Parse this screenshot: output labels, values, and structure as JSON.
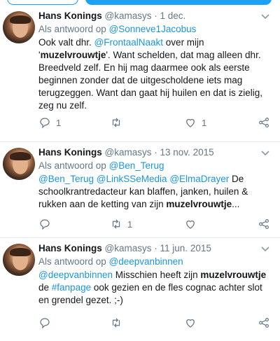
{
  "tweets": [
    {
      "name": "Hans Konings",
      "handle": "@kamasys",
      "sep": "·",
      "date": "1 dec.",
      "reply_prefix": "Als antwoord op ",
      "reply_handles": [
        "@Sonneve1Jacobus"
      ],
      "body": [
        {
          "t": "Ook valt dhr. "
        },
        {
          "t": "@FrontaalNaakt",
          "link": true
        },
        {
          "t": " over mijn '"
        },
        {
          "t": "muzelvrouwtje",
          "bold": true
        },
        {
          "t": "'. Want schelden, dat mag alleen dhr. Breedveld zelf. En hij mag daarmee ook als eerste beginnen zonder dat de uitgescholdene iets mag terugzeggen. Want dan gaat hij huilen en dat is zielig, zeg nu zelf."
        }
      ],
      "counts": {
        "reply": "1",
        "retweet": "",
        "like": "1"
      }
    },
    {
      "name": "Hans Konings",
      "handle": "@kamasys",
      "sep": "·",
      "date": "13 nov. 2015",
      "reply_prefix": "Als antwoord op ",
      "reply_handles": [
        "@Ben_Terug"
      ],
      "body": [
        {
          "t": "@Ben_Terug",
          "link": true
        },
        {
          "t": " "
        },
        {
          "t": "@LinkSSeMedia",
          "link": true
        },
        {
          "t": " "
        },
        {
          "t": "@ElmaDrayer",
          "link": true
        },
        {
          "t": " De schoolkrantredacteur kan blaffen, janken, huilen & rukken aan de ketting van zijn "
        },
        {
          "t": "muzelvrouwtje",
          "bold": true
        },
        {
          "t": "..."
        }
      ],
      "counts": {
        "reply": "",
        "retweet": "1",
        "like": ""
      }
    },
    {
      "name": "Hans Konings",
      "handle": "@kamasys",
      "sep": "·",
      "date": "11 jun. 2015",
      "reply_prefix": "Als antwoord op ",
      "reply_handles": [
        "@deepvanbinnen"
      ],
      "body": [
        {
          "t": "@deepvanbinnen",
          "link": true
        },
        {
          "t": " Misschien heeft zijn "
        },
        {
          "t": "muzelvrouwtje",
          "bold": true
        },
        {
          "t": " de "
        },
        {
          "t": "#fanpage",
          "link": true
        },
        {
          "t": " ook gezien en de fles cognac achter slot en grendel gezet. ;-)"
        }
      ],
      "counts": {
        "reply": "",
        "retweet": "",
        "like": ""
      }
    }
  ],
  "icons": [
    "reply-icon",
    "retweet-icon",
    "like-icon",
    "share-icon",
    "chevron-down-icon"
  ],
  "colors": {
    "link": "#1b95e0",
    "muted": "#657786",
    "accent": "#1da1f2",
    "divider": "#e6ecf0"
  }
}
